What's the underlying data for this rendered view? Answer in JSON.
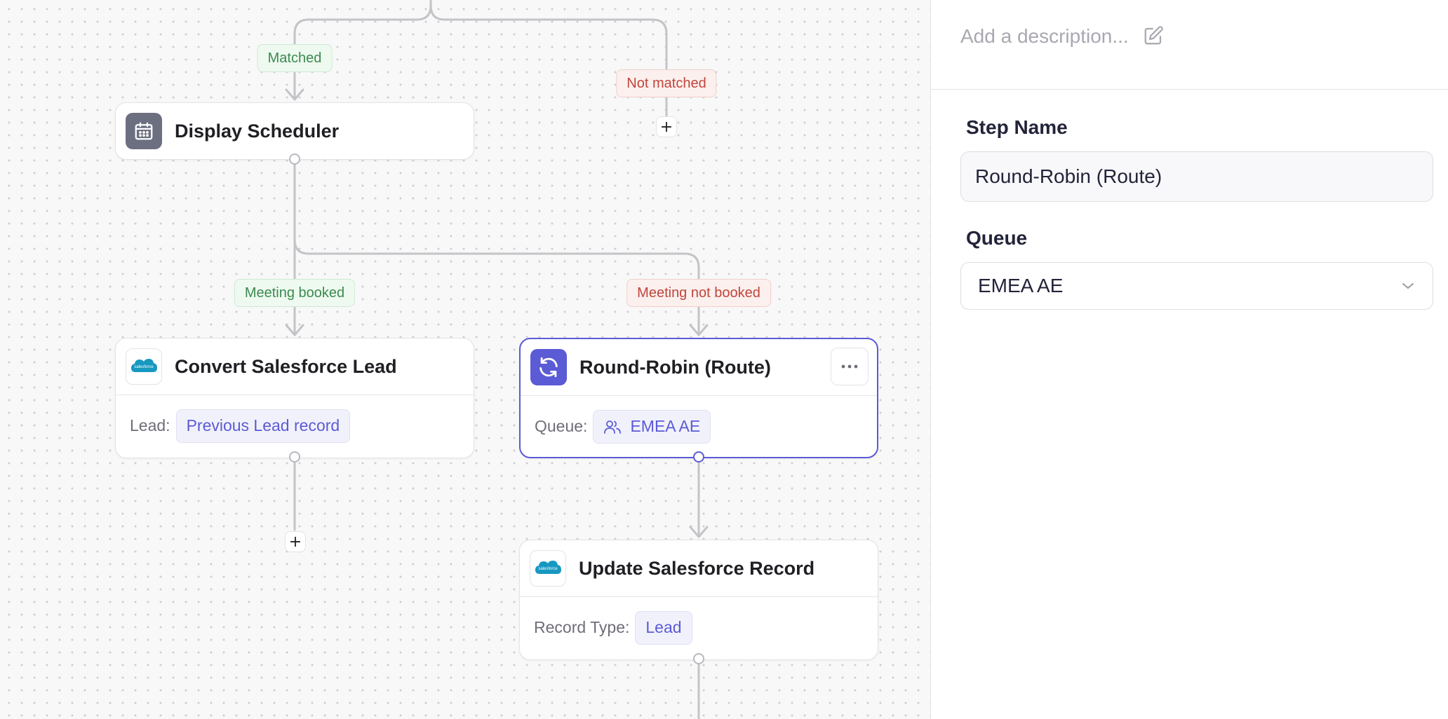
{
  "canvas": {
    "edge_labels": {
      "matched": "Matched",
      "not_matched": "Not matched",
      "meeting_booked": "Meeting booked",
      "meeting_not_booked": "Meeting not booked"
    },
    "add_symbol": "+",
    "nodes": {
      "display_scheduler": {
        "title": "Display Scheduler",
        "icon": "calendar-icon"
      },
      "convert_lead": {
        "title": "Convert Salesforce Lead",
        "icon": "salesforce-icon",
        "field_label": "Lead:",
        "field_value": "Previous Lead record"
      },
      "round_robin": {
        "title": "Round-Robin (Route)",
        "icon": "refresh-icon",
        "field_label": "Queue:",
        "field_value": "EMEA AE",
        "field_icon": "users-icon"
      },
      "update_record": {
        "title": "Update Salesforce Record",
        "icon": "salesforce-icon",
        "field_label": "Record Type:",
        "field_value": "Lead"
      }
    },
    "salesforce_logo_text": "salesforce"
  },
  "panel": {
    "description_placeholder": "Add a description...",
    "step_name_label": "Step Name",
    "step_name_value": "Round-Robin (Route)",
    "queue_label": "Queue",
    "queue_value": "EMEA AE"
  },
  "colors": {
    "accent": "#5b5bd6",
    "matched_green": "#3b8a4f",
    "not_matched_red": "#c2453a",
    "salesforce_blue": "#1798c1"
  }
}
